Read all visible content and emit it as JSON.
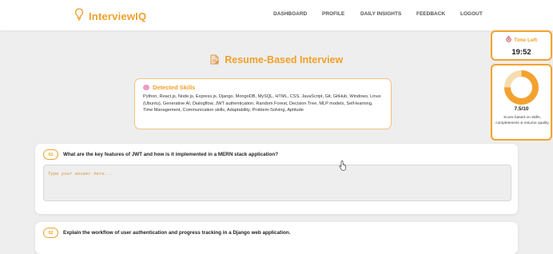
{
  "brand": {
    "name": "InterviewIQ",
    "icon": "lightbulb-icon",
    "color": "#f0a02a"
  },
  "nav": [
    {
      "label": "DASHBOARD"
    },
    {
      "label": "PROFILE"
    },
    {
      "label": "DAILY INSIGHTS"
    },
    {
      "label": "FEEDBACK"
    },
    {
      "label": "LOGOUT"
    }
  ],
  "page": {
    "title": "Resume-Based Interview",
    "title_icon": "document-icon"
  },
  "skills": {
    "title": "Detected Skills",
    "icon": "brain-icon",
    "text": "Python, React.js, Node.js, Express.js, Django, MongoDB, MySQL, HTML, CSS, JavaScript, Git, GitHub, Windows, Linux (Ubuntu), Generative AI, Dialogflow, JWT authentication, Random Forest, Decision Tree, MLP models, Self-learning, Time Management, Communication skills, Adaptability, Problem-Solving, Aptitude"
  },
  "timer": {
    "label": "Time Left",
    "icon": "stopwatch-icon",
    "value": "19:52"
  },
  "score": {
    "value": "7.5/10",
    "fraction": 0.75,
    "note": "Score based on skills, completeness & resume quality",
    "ring_color": "#f3a230",
    "track_color": "#f5ddb0"
  },
  "questions": [
    {
      "number": "01",
      "text": "What are the key features of JWT and how is it implemented in a MERN stack application?",
      "placeholder": "Type your answer here..."
    },
    {
      "number": "02",
      "text": "Explain the workflow of user authentication and progress tracking in a Django web application."
    }
  ]
}
